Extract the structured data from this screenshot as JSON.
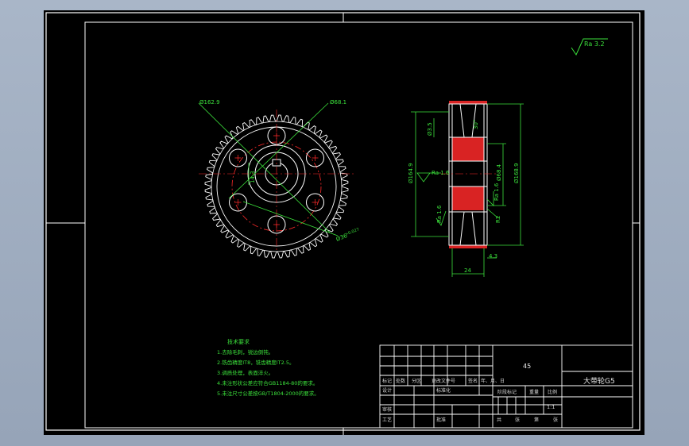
{
  "drawing": {
    "surface_finish": "Ra 3.2",
    "front_view": {
      "dim_root": "Ø162.9",
      "dim_pitch": "Ø68.1",
      "dim_key_width": "14.3",
      "dim_bore": "Ø36",
      "dim_bore_tol": "+0.027"
    },
    "section_view": {
      "dim_outer": "Ø164.9",
      "dim_inner": "Ø168.9",
      "dim_mid": "Ø68.4",
      "dim_tooth": "Ø3.5",
      "dim_angle": "30°",
      "roughness_1": "Ra 1.6",
      "roughness_2": "Ra 1.6",
      "roughness_3": "Ra 1.6",
      "chamfer": "R2",
      "dim_offset": "4.3",
      "dim_width": "24"
    }
  },
  "tech_requirements": {
    "heading": "技术要求",
    "items": [
      "1.去除毛刺，锐边倒钝。",
      "2.铣齿精度IT8，铣齿精度IT2.5。",
      "3.调质处理，表面淬火。",
      "4.未注形状公差应符合GB1184-80的要求。",
      "5.未注尺寸公差按GB/T1804-2000的要求。"
    ]
  },
  "title_block": {
    "material": "45",
    "part_name": "大带轮G5",
    "scale": "1:1",
    "row_labels": [
      "标记",
      "处数",
      "分区",
      "更改文件号",
      "签名",
      "年、月、日"
    ],
    "designer_row": [
      "设计",
      "",
      "",
      "标准化"
    ],
    "stage_labels": [
      "阶段标记",
      "重量",
      "比例"
    ],
    "review": "审核",
    "process": "工艺",
    "approve": "批准",
    "sheets": [
      "共",
      "张",
      "第",
      "张"
    ]
  },
  "colors": {
    "background": "#000000",
    "frame": "#ffffff",
    "geometry": "#ffffff",
    "dimension": "#3be03b",
    "center_line": "#ff2a2a",
    "hatch": "#ff2a2a"
  }
}
